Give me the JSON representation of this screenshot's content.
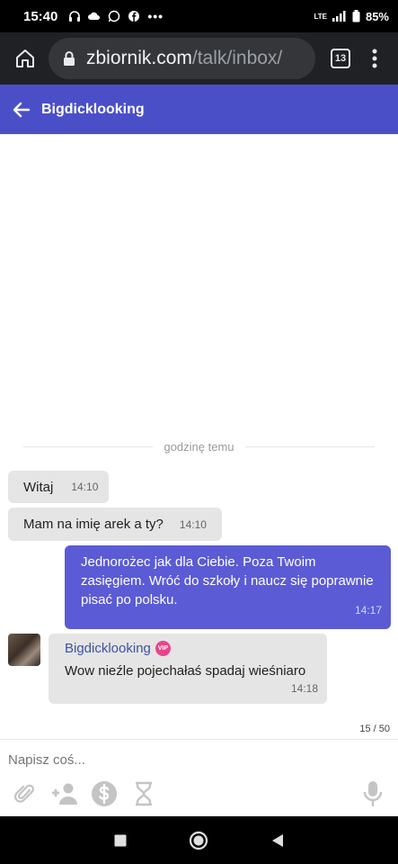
{
  "status_bar": {
    "time": "15:40",
    "battery": "85%",
    "network": "LTE"
  },
  "browser": {
    "url_host": "zbiornik.com",
    "url_path": "/talk/inbox/",
    "tab_count": "13"
  },
  "header": {
    "title": "Bigdicklooking"
  },
  "chat": {
    "separator": "godzinę temu",
    "messages": [
      {
        "direction": "in",
        "text": "Witaj",
        "time": "14:10"
      },
      {
        "direction": "in",
        "text": "Mam na imię arek a ty?",
        "time": "14:10"
      },
      {
        "direction": "out",
        "text": "Jednorożec jak dla Ciebie. Poza Twoim zasięgiem. Wróć do szkoły i naucz się poprawnie pisać po polsku.",
        "time": "14:17"
      },
      {
        "direction": "in",
        "sender": "Bigdicklooking",
        "badge": "VIP",
        "text": "Wow nieźle pojechałaś spadaj wieśniaro",
        "time": "14:18"
      }
    ],
    "counter": "15 / 50"
  },
  "composer": {
    "placeholder": "Napisz coś...",
    "tools": [
      "paperclip-icon",
      "add-user-icon",
      "dollar-icon",
      "hourglass-icon"
    ],
    "mic": "microphone-icon"
  },
  "colors": {
    "header": "#4a4fc8",
    "outgoing_bubble": "#5b5bd6",
    "incoming_bubble": "#e5e5e5",
    "vip_badge": "#e8458b",
    "sender_name": "#3d52a8"
  }
}
